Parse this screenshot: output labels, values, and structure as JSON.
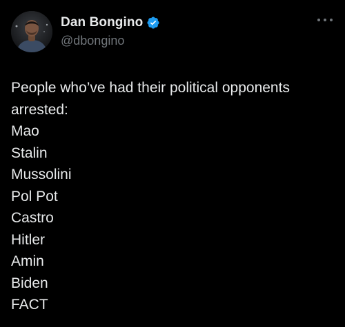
{
  "author": {
    "display_name": "Dan Bongino",
    "handle": "@dbongino",
    "verified": true,
    "avatar_icon": "profile-photo",
    "verified_icon": "verified-badge-icon",
    "verified_color": "#1d9bf0"
  },
  "more_icon": "more-options-icon",
  "tweet": {
    "lines": [
      "People who’ve had their political opponents",
      "arrested:",
      "Mao",
      "Stalin",
      "Mussolini",
      "Pol Pot",
      "Castro",
      "Hitler",
      "Amin",
      "Biden",
      "FACT"
    ]
  },
  "colors": {
    "background": "#000000",
    "text_primary": "#e7e9ea",
    "text_secondary": "#71767b"
  }
}
